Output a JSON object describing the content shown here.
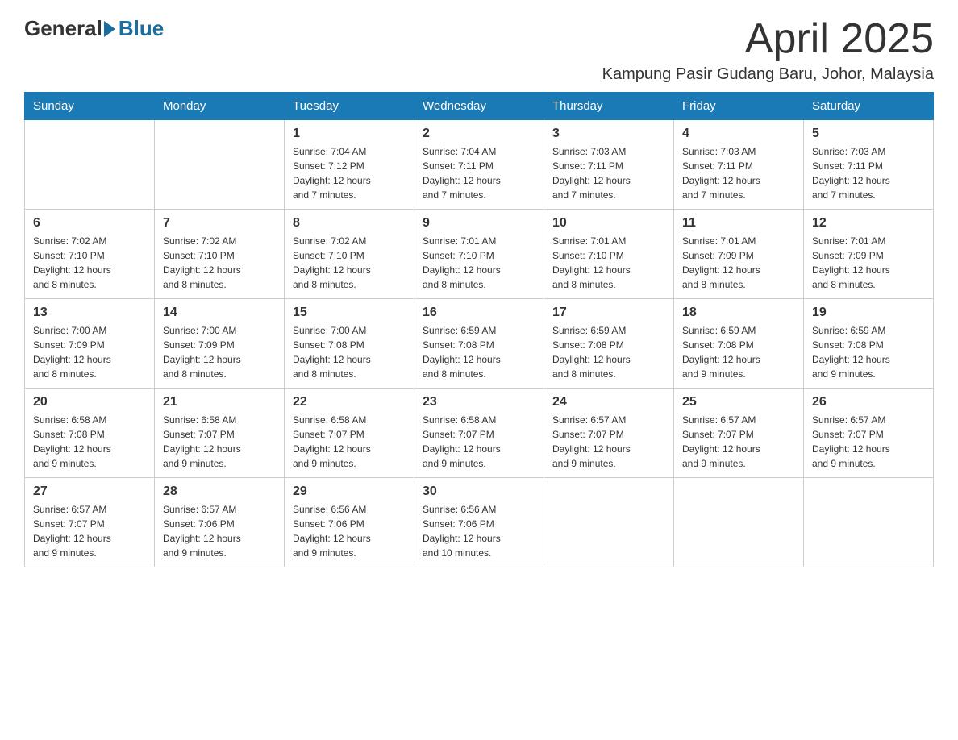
{
  "logo": {
    "general": "General",
    "blue": "Blue"
  },
  "title": "April 2025",
  "location": "Kampung Pasir Gudang Baru, Johor, Malaysia",
  "weekdays": [
    "Sunday",
    "Monday",
    "Tuesday",
    "Wednesday",
    "Thursday",
    "Friday",
    "Saturday"
  ],
  "weeks": [
    [
      {
        "day": "",
        "info": ""
      },
      {
        "day": "",
        "info": ""
      },
      {
        "day": "1",
        "info": "Sunrise: 7:04 AM\nSunset: 7:12 PM\nDaylight: 12 hours\nand 7 minutes."
      },
      {
        "day": "2",
        "info": "Sunrise: 7:04 AM\nSunset: 7:11 PM\nDaylight: 12 hours\nand 7 minutes."
      },
      {
        "day": "3",
        "info": "Sunrise: 7:03 AM\nSunset: 7:11 PM\nDaylight: 12 hours\nand 7 minutes."
      },
      {
        "day": "4",
        "info": "Sunrise: 7:03 AM\nSunset: 7:11 PM\nDaylight: 12 hours\nand 7 minutes."
      },
      {
        "day": "5",
        "info": "Sunrise: 7:03 AM\nSunset: 7:11 PM\nDaylight: 12 hours\nand 7 minutes."
      }
    ],
    [
      {
        "day": "6",
        "info": "Sunrise: 7:02 AM\nSunset: 7:10 PM\nDaylight: 12 hours\nand 8 minutes."
      },
      {
        "day": "7",
        "info": "Sunrise: 7:02 AM\nSunset: 7:10 PM\nDaylight: 12 hours\nand 8 minutes."
      },
      {
        "day": "8",
        "info": "Sunrise: 7:02 AM\nSunset: 7:10 PM\nDaylight: 12 hours\nand 8 minutes."
      },
      {
        "day": "9",
        "info": "Sunrise: 7:01 AM\nSunset: 7:10 PM\nDaylight: 12 hours\nand 8 minutes."
      },
      {
        "day": "10",
        "info": "Sunrise: 7:01 AM\nSunset: 7:10 PM\nDaylight: 12 hours\nand 8 minutes."
      },
      {
        "day": "11",
        "info": "Sunrise: 7:01 AM\nSunset: 7:09 PM\nDaylight: 12 hours\nand 8 minutes."
      },
      {
        "day": "12",
        "info": "Sunrise: 7:01 AM\nSunset: 7:09 PM\nDaylight: 12 hours\nand 8 minutes."
      }
    ],
    [
      {
        "day": "13",
        "info": "Sunrise: 7:00 AM\nSunset: 7:09 PM\nDaylight: 12 hours\nand 8 minutes."
      },
      {
        "day": "14",
        "info": "Sunrise: 7:00 AM\nSunset: 7:09 PM\nDaylight: 12 hours\nand 8 minutes."
      },
      {
        "day": "15",
        "info": "Sunrise: 7:00 AM\nSunset: 7:08 PM\nDaylight: 12 hours\nand 8 minutes."
      },
      {
        "day": "16",
        "info": "Sunrise: 6:59 AM\nSunset: 7:08 PM\nDaylight: 12 hours\nand 8 minutes."
      },
      {
        "day": "17",
        "info": "Sunrise: 6:59 AM\nSunset: 7:08 PM\nDaylight: 12 hours\nand 8 minutes."
      },
      {
        "day": "18",
        "info": "Sunrise: 6:59 AM\nSunset: 7:08 PM\nDaylight: 12 hours\nand 9 minutes."
      },
      {
        "day": "19",
        "info": "Sunrise: 6:59 AM\nSunset: 7:08 PM\nDaylight: 12 hours\nand 9 minutes."
      }
    ],
    [
      {
        "day": "20",
        "info": "Sunrise: 6:58 AM\nSunset: 7:08 PM\nDaylight: 12 hours\nand 9 minutes."
      },
      {
        "day": "21",
        "info": "Sunrise: 6:58 AM\nSunset: 7:07 PM\nDaylight: 12 hours\nand 9 minutes."
      },
      {
        "day": "22",
        "info": "Sunrise: 6:58 AM\nSunset: 7:07 PM\nDaylight: 12 hours\nand 9 minutes."
      },
      {
        "day": "23",
        "info": "Sunrise: 6:58 AM\nSunset: 7:07 PM\nDaylight: 12 hours\nand 9 minutes."
      },
      {
        "day": "24",
        "info": "Sunrise: 6:57 AM\nSunset: 7:07 PM\nDaylight: 12 hours\nand 9 minutes."
      },
      {
        "day": "25",
        "info": "Sunrise: 6:57 AM\nSunset: 7:07 PM\nDaylight: 12 hours\nand 9 minutes."
      },
      {
        "day": "26",
        "info": "Sunrise: 6:57 AM\nSunset: 7:07 PM\nDaylight: 12 hours\nand 9 minutes."
      }
    ],
    [
      {
        "day": "27",
        "info": "Sunrise: 6:57 AM\nSunset: 7:07 PM\nDaylight: 12 hours\nand 9 minutes."
      },
      {
        "day": "28",
        "info": "Sunrise: 6:57 AM\nSunset: 7:06 PM\nDaylight: 12 hours\nand 9 minutes."
      },
      {
        "day": "29",
        "info": "Sunrise: 6:56 AM\nSunset: 7:06 PM\nDaylight: 12 hours\nand 9 minutes."
      },
      {
        "day": "30",
        "info": "Sunrise: 6:56 AM\nSunset: 7:06 PM\nDaylight: 12 hours\nand 10 minutes."
      },
      {
        "day": "",
        "info": ""
      },
      {
        "day": "",
        "info": ""
      },
      {
        "day": "",
        "info": ""
      }
    ]
  ]
}
